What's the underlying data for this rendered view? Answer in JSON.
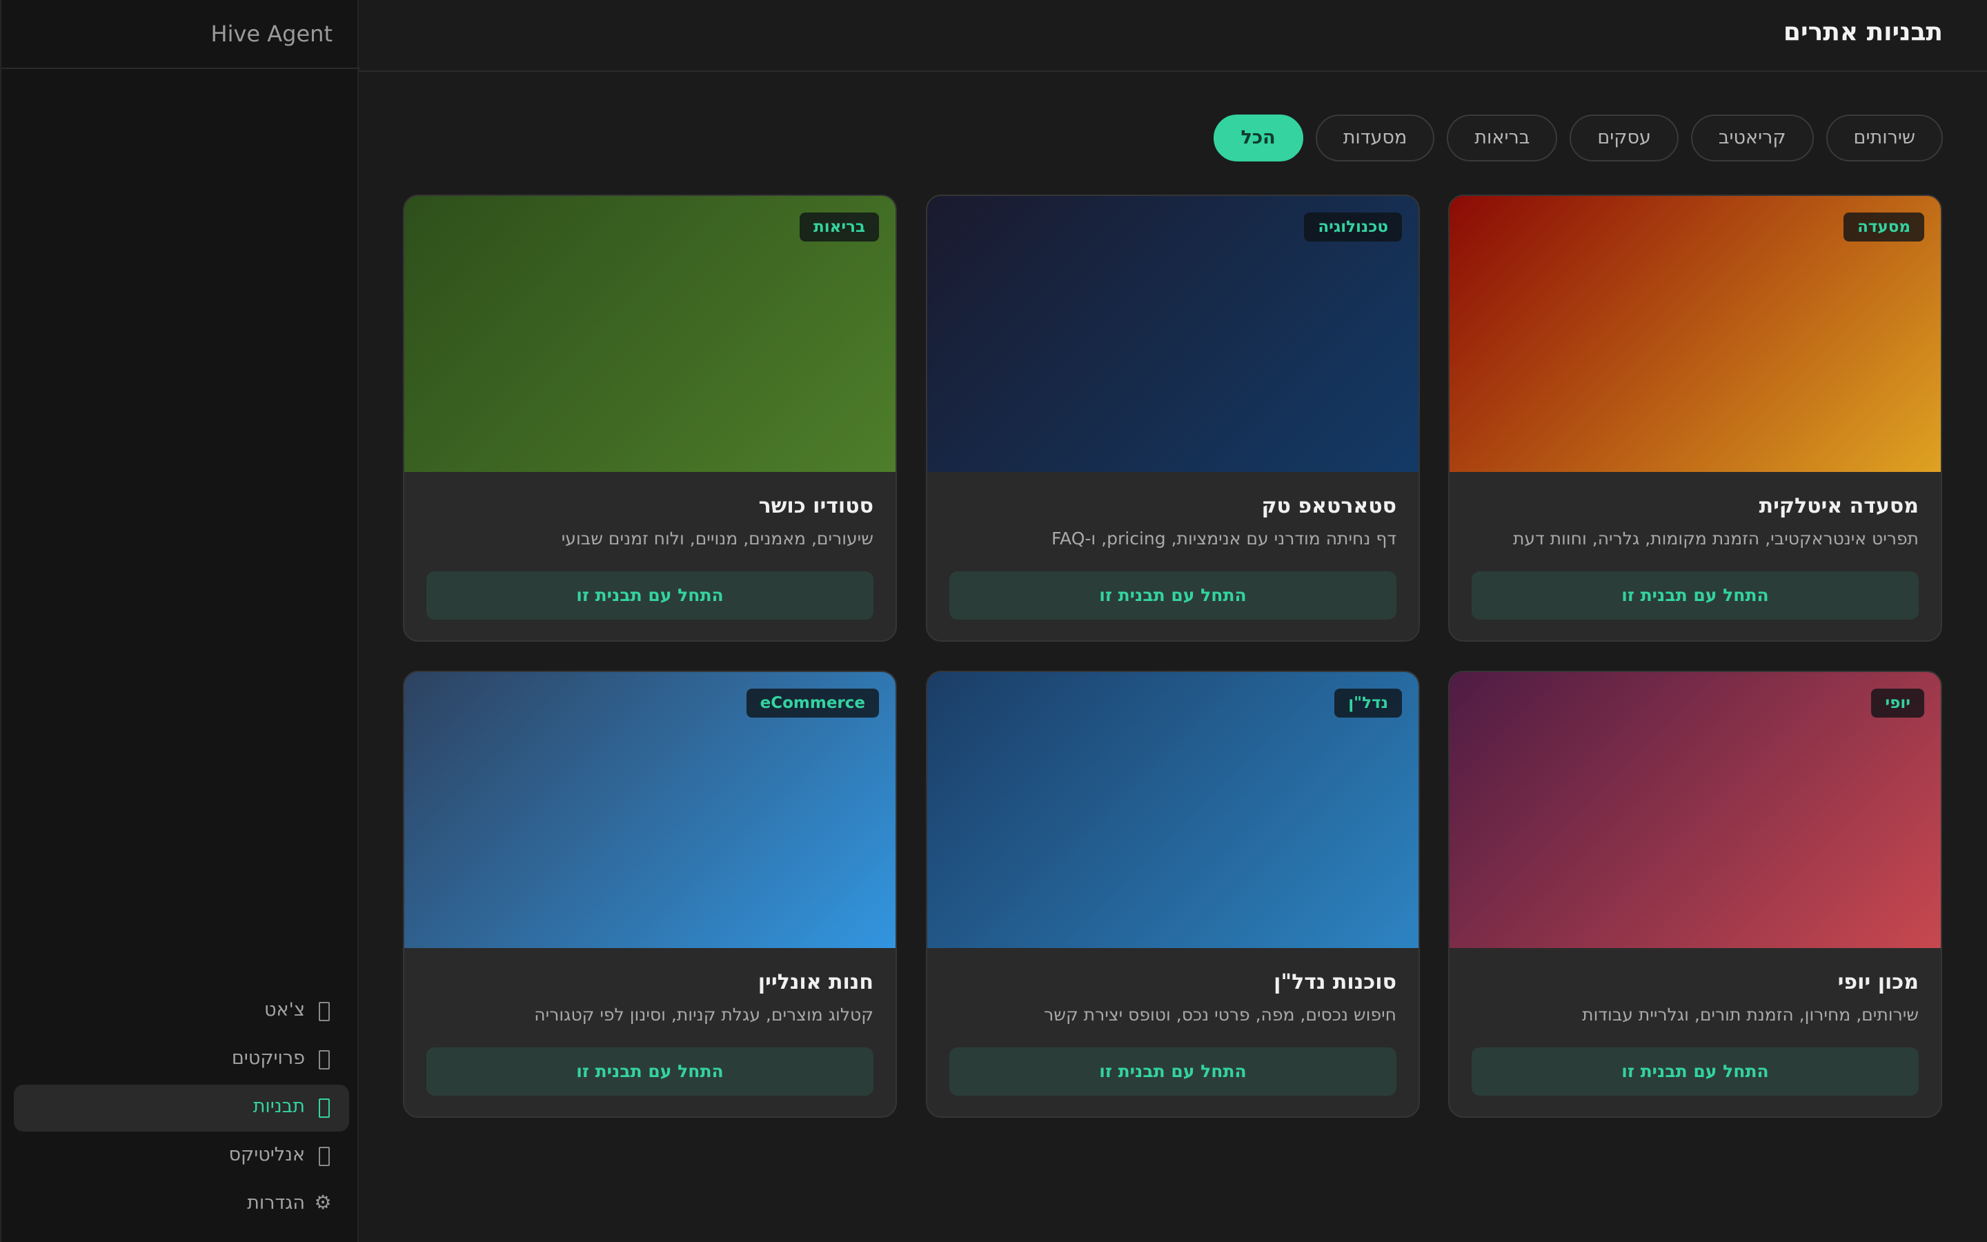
{
  "app": {
    "name": "Hive Agent"
  },
  "sidebar": {
    "items": [
      {
        "label": "צ'אט",
        "icon": "chat-icon",
        "active": false
      },
      {
        "label": "פרויקטים",
        "icon": "projects-icon",
        "active": false
      },
      {
        "label": "תבניות",
        "icon": "templates-icon",
        "active": true
      },
      {
        "label": "אנליטיקס",
        "icon": "analytics-icon",
        "active": false
      },
      {
        "label": "הגדרות",
        "icon": "gear-icon",
        "glyph": "⚙",
        "active": false
      }
    ]
  },
  "page": {
    "title": "תבניות אתרים"
  },
  "filters": [
    {
      "label": "הכל",
      "active": true
    },
    {
      "label": "מסעדות",
      "active": false
    },
    {
      "label": "בריאות",
      "active": false
    },
    {
      "label": "עסקים",
      "active": false
    },
    {
      "label": "קריאטיב",
      "active": false
    },
    {
      "label": "שירותים",
      "active": false
    }
  ],
  "templates": [
    {
      "badge": "מסעדה",
      "title": "מסעדה איטלקית",
      "description": "תפריט אינטראקטיבי, הזמנת מקומות, גלריה, וחוות דעת",
      "button": "התחל עם תבנית זו",
      "gradient_from": "#8b0a05",
      "gradient_to": "#dfa322"
    },
    {
      "badge": "טכנולוגיה",
      "title": "סטארטאפ טק",
      "description": "דף נחיתה מודרני עם אנימציות, pricing, ו-FAQ",
      "button": "התחל עם תבנית זו",
      "gradient_from": "#1a1a2e",
      "gradient_to": "#133a66"
    },
    {
      "badge": "בריאות",
      "title": "סטודיו כושר",
      "description": "שיעורים, מאמנים, מנויים, ולוח זמנים שבועי",
      "button": "התחל עם תבנית זו",
      "gradient_from": "#2e4f1b",
      "gradient_to": "#4e7e2a"
    },
    {
      "badge": "יופי",
      "title": "מכון יופי",
      "description": "שירותים, מחירון, הזמנת תורים, וגלריית עבודות",
      "button": "התחל עם תבנית זו",
      "gradient_from": "#4e1c44",
      "gradient_to": "#c8484f"
    },
    {
      "badge": "נדל\"ן",
      "title": "סוכנות נדל\"ן",
      "description": "חיפוש נכסים, מפה, פרטי נכס, וטופס יצירת קשר",
      "button": "התחל עם תבנית זו",
      "gradient_from": "#1b3d66",
      "gradient_to": "#2d84c2"
    },
    {
      "badge": "eCommerce",
      "title": "חנות אונליין",
      "description": "קטלוג מוצרים, עגלת קניות, וסינון לפי קטגוריה",
      "button": "התחל עם תבנית זו",
      "gradient_from": "#2e4260",
      "gradient_to": "#3296e0"
    }
  ],
  "colors": {
    "accent": "#34d3a0",
    "background": "#1b1b1b",
    "card": "#2a2a2a",
    "sidebar": "#141414"
  }
}
